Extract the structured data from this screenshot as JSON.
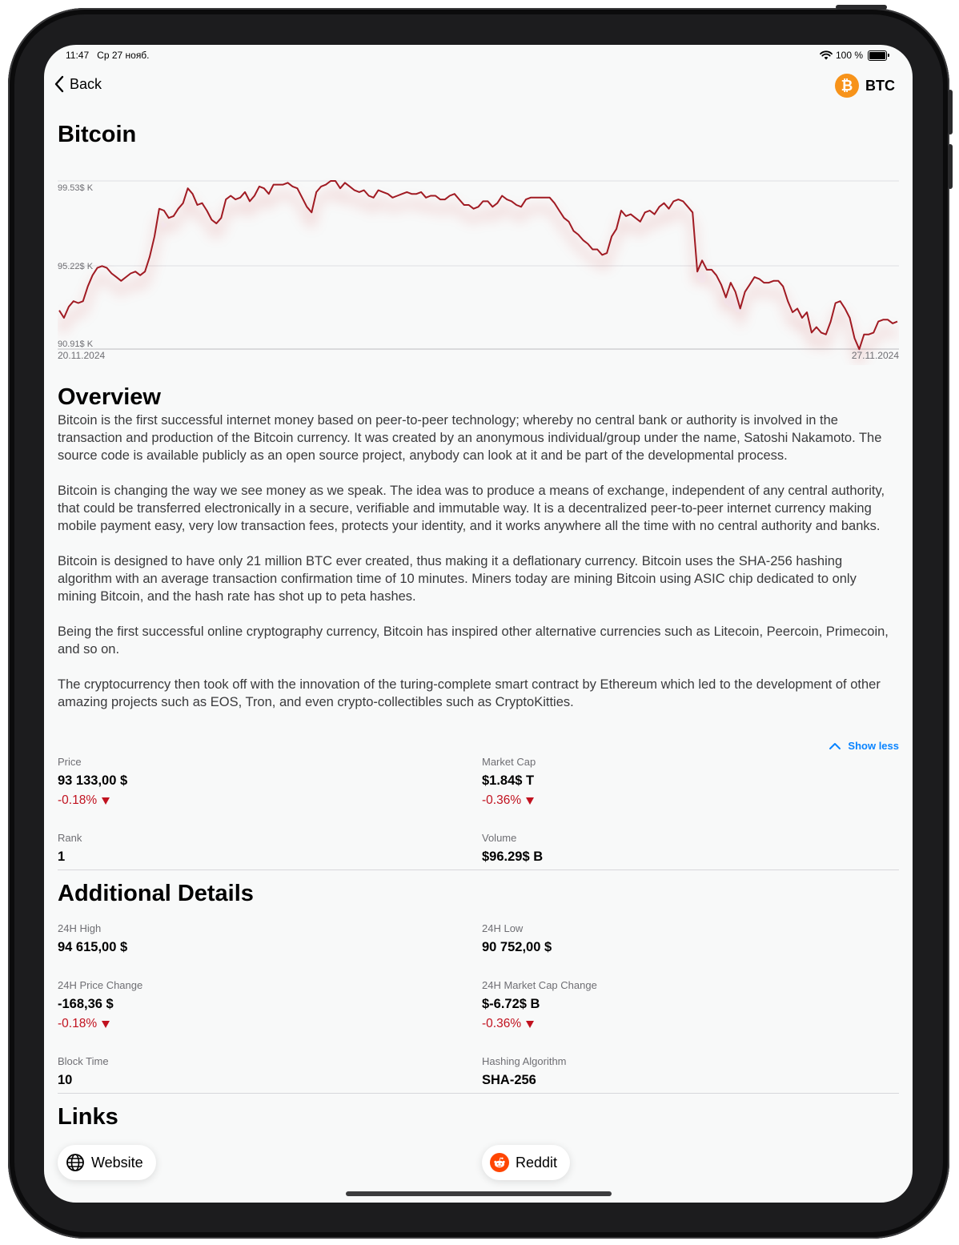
{
  "status_bar": {
    "time": "11:47",
    "date": "Ср 27 нояб.",
    "battery": "100 %"
  },
  "nav": {
    "back_label": "Back",
    "coin_symbol": "BTC"
  },
  "title": "Bitcoin",
  "chart_data": {
    "type": "line",
    "color": "#a01a22",
    "y_tick_labels": [
      "99.53$ K",
      "95.22$ K",
      "90.91$ K"
    ],
    "y_ticks": [
      99.53,
      95.22,
      90.91
    ],
    "ylim": [
      90.91,
      99.53
    ],
    "x_start_label": "20.11.2024",
    "x_end_label": "27.11.2024",
    "values": [
      93.0,
      92.6,
      93.2,
      93.5,
      93.4,
      93.5,
      94.3,
      94.9,
      95.3,
      95.4,
      95.3,
      95.0,
      94.8,
      94.6,
      94.8,
      95.0,
      95.1,
      94.9,
      95.1,
      95.9,
      97.0,
      98.5,
      98.4,
      98.0,
      98.1,
      98.5,
      98.8,
      99.6,
      99.3,
      98.7,
      98.8,
      98.4,
      97.9,
      97.7,
      98.0,
      99.0,
      99.2,
      99.0,
      99.1,
      99.4,
      98.9,
      99.2,
      99.7,
      99.6,
      99.3,
      99.8,
      99.8,
      99.8,
      99.9,
      99.7,
      99.6,
      99.1,
      98.6,
      98.3,
      99.4,
      99.7,
      99.8,
      100.0,
      100.0,
      99.6,
      99.9,
      99.7,
      99.5,
      99.4,
      99.5,
      99.2,
      99.1,
      99.5,
      99.4,
      99.3,
      99.1,
      99.2,
      99.3,
      99.4,
      99.3,
      99.3,
      99.4,
      99.1,
      99.2,
      99.2,
      99.0,
      99.0,
      99.2,
      99.3,
      99.0,
      98.7,
      98.7,
      98.5,
      98.6,
      98.9,
      98.9,
      98.6,
      98.8,
      99.2,
      99.0,
      98.9,
      98.7,
      98.6,
      99.0,
      99.1,
      99.1,
      99.1,
      99.1,
      99.1,
      98.8,
      98.4,
      98.0,
      97.8,
      97.3,
      97.1,
      96.8,
      96.6,
      96.3,
      96.3,
      96.0,
      96.1,
      97.0,
      97.4,
      98.4,
      98.1,
      98.2,
      98.0,
      97.8,
      98.3,
      98.4,
      98.2,
      98.6,
      98.8,
      98.5,
      98.9,
      99.0,
      98.9,
      98.6,
      98.3,
      95.1,
      95.7,
      95.2,
      95.2,
      94.9,
      94.4,
      93.7,
      94.5,
      94.0,
      93.1,
      94.0,
      94.4,
      94.8,
      94.7,
      94.5,
      94.5,
      94.6,
      94.6,
      94.3,
      93.5,
      92.9,
      93.1,
      92.6,
      92.9,
      91.8,
      92.1,
      91.8,
      91.7,
      92.4,
      93.4,
      93.5,
      93.1,
      92.6,
      91.5,
      90.9,
      91.7,
      91.7,
      91.8,
      92.4,
      92.5,
      92.5,
      92.3,
      92.4
    ]
  },
  "overview": {
    "title": "Overview",
    "paragraphs": [
      "Bitcoin is the first successful internet money based on peer-to-peer technology; whereby no central bank or authority is involved in the transaction and production of the Bitcoin currency. It was created by an anonymous individual/group under the name, Satoshi Nakamoto. The source code is available publicly as an open source project, anybody can look at it and be part of the developmental process.",
      "Bitcoin is changing the way we see money as we speak. The idea was to produce a means of exchange, independent of any central authority, that could be transferred electronically in a secure, verifiable and immutable way. It is a decentralized peer-to-peer internet currency making mobile payment easy, very low transaction fees, protects your identity, and it works anywhere all the time with no central authority and banks.",
      "Bitcoin is designed to have only 21 million BTC ever created, thus making it a deflationary currency. Bitcoin uses the SHA-256 hashing algorithm with an average transaction confirmation time of 10 minutes. Miners today are mining Bitcoin using ASIC chip dedicated to only mining Bitcoin, and the hash rate has shot up to peta hashes.",
      "Being the first successful online cryptography currency, Bitcoin has inspired other alternative currencies such as Litecoin, Peercoin, Primecoin, and so on.",
      "The cryptocurrency then took off with the innovation of the turing-complete smart contract by Ethereum which led to the development of other amazing projects such as EOS, Tron, and even crypto-collectibles such as CryptoKitties."
    ],
    "show_less": "Show less"
  },
  "stats": {
    "price": {
      "label": "Price",
      "value": "93 133,00 $",
      "change": "-0.18%"
    },
    "market_cap": {
      "label": "Market Cap",
      "value": "$1.84$ T",
      "change": "-0.36%"
    },
    "rank": {
      "label": "Rank",
      "value": "1"
    },
    "volume": {
      "label": "Volume",
      "value": "$96.29$ B"
    }
  },
  "additional": {
    "title": "Additional Details",
    "high": {
      "label": "24H High",
      "value": "94 615,00 $"
    },
    "low": {
      "label": "24H Low",
      "value": "90 752,00 $"
    },
    "price_change": {
      "label": "24H Price Change",
      "value": "-168,36 $",
      "change": "-0.18%"
    },
    "mcap_change": {
      "label": "24H Market Cap Change",
      "value": "$-6.72$ B",
      "change": "-0.36%"
    },
    "block_time": {
      "label": "Block Time",
      "value": "10"
    },
    "hashing": {
      "label": "Hashing Algorithm",
      "value": "SHA-256"
    }
  },
  "links": {
    "title": "Links",
    "website_label": "Website",
    "reddit_label": "Reddit"
  },
  "colors": {
    "accent": "#0a84ff",
    "negative": "#c1121f",
    "bitcoin": "#f7931a",
    "reddit": "#ff4500"
  }
}
